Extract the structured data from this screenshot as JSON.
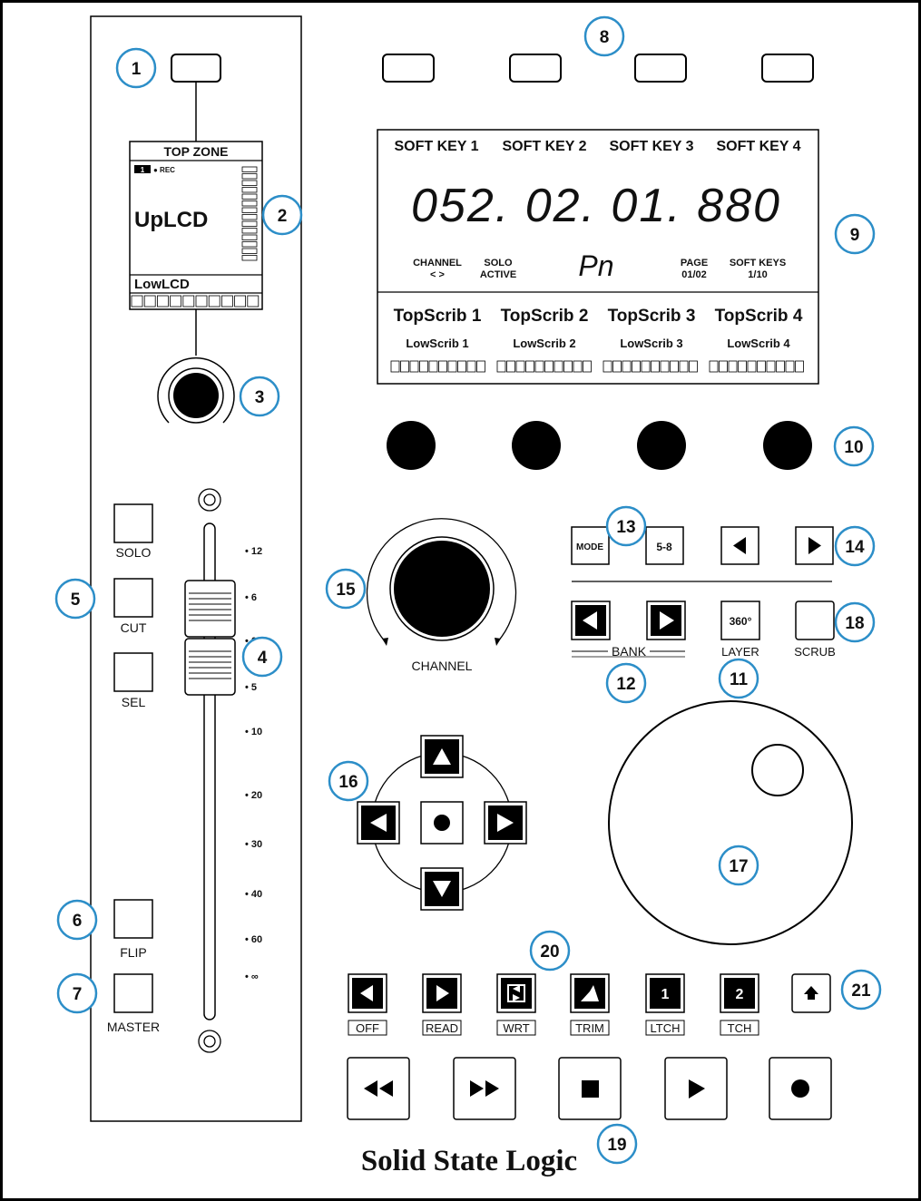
{
  "brand": "Solid State Logic",
  "callouts": [
    "1",
    "2",
    "3",
    "4",
    "5",
    "6",
    "7",
    "8",
    "9",
    "10",
    "11",
    "12",
    "13",
    "14",
    "15",
    "16",
    "17",
    "18",
    "19",
    "20",
    "21"
  ],
  "channel_strip": {
    "top_zone": "TOP ZONE",
    "rec_badge": "1",
    "rec_label": "● REC",
    "up_lcd": "UpLCD",
    "low_lcd": "LowLCD",
    "buttons": {
      "solo": "SOLO",
      "cut": "CUT",
      "sel": "SEL",
      "flip": "FLIP",
      "master": "MASTER"
    },
    "fader_scale": [
      "• 12",
      "• 6",
      "• 0",
      "• 5",
      "• 10",
      "• 20",
      "• 30",
      "• 40",
      "• 60",
      "• ∞"
    ]
  },
  "display": {
    "soft_keys": [
      "SOFT KEY 1",
      "SOFT KEY 2",
      "SOFT KEY 3",
      "SOFT KEY 4"
    ],
    "timecode": "052. 02. 01. 880",
    "channel_label": "CHANNEL",
    "channel_arrows": "< >",
    "solo_label": "SOLO",
    "solo_state": "ACTIVE",
    "mode_glyph": "Pn",
    "page_label": "PAGE",
    "page_value": "01/02",
    "softkeys_label": "SOFT KEYS",
    "softkeys_value": "1/10",
    "top_scribs": [
      "TopScrib 1",
      "TopScrib 2",
      "TopScrib 3",
      "TopScrib 4"
    ],
    "low_scribs": [
      "LowScrib 1",
      "LowScrib 2",
      "LowScrib 3",
      "LowScrib 4"
    ]
  },
  "controls": {
    "mode": "MODE",
    "five_eight": "5-8",
    "bank": "BANK",
    "layer": "LAYER",
    "layer_key": "360°",
    "scrub": "SCRUB",
    "channel": "CHANNEL"
  },
  "automation": {
    "labels": [
      "OFF",
      "READ",
      "WRT",
      "TRIM",
      "LTCH",
      "TCH"
    ],
    "key_1": "1",
    "key_2": "2"
  }
}
